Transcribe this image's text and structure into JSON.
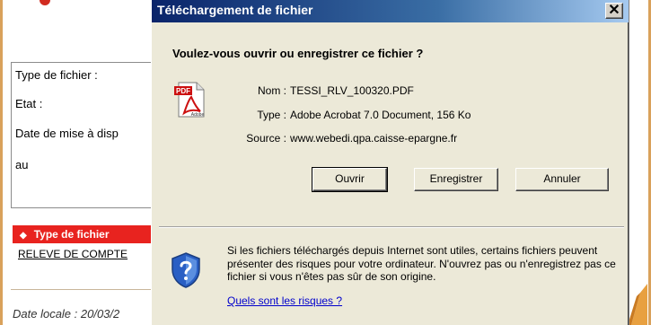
{
  "background": {
    "rows": [
      "Type de fichier :",
      "Etat :",
      "Date de mise à disp",
      "au"
    ],
    "tab_label": "Type de fichier",
    "link_text": "RELEVE DE COMPTE",
    "local_date": "Date locale : 20/03/2"
  },
  "dialog": {
    "title": "Téléchargement de fichier",
    "close_glyph": "✕",
    "question": "Voulez-vous ouvrir ou enregistrer ce fichier ?",
    "fields": {
      "name_label": "Nom :",
      "name_value": "TESSI_RLV_100320.PDF",
      "type_label": "Type :",
      "type_value": "Adobe Acrobat 7.0 Document, 156 Ko",
      "source_label": "Source :",
      "source_value": "www.webedi.qpa.caisse-epargne.fr"
    },
    "buttons": {
      "open": "Ouvrir",
      "save": "Enregistrer",
      "cancel": "Annuler"
    },
    "warning_text": "Si les fichiers téléchargés depuis Internet sont utiles, certains fichiers peuvent présenter des risques pour votre ordinateur. N'ouvrez pas ou n'enregistrez pas ce fichier si vous n'êtes pas sûr de son origine.",
    "risk_link": "Quels sont les risques ?",
    "icons": {
      "file": "pdf-file-icon",
      "security": "shield-question-icon"
    },
    "pdf_badge": "PDF",
    "adobe_badge": "Adobe"
  },
  "colors": {
    "titlebar_start": "#0a246a",
    "titlebar_end": "#a6caf0",
    "dialog_face": "#ece9d8",
    "tab_red": "#e8231f",
    "link_blue": "#0000cc"
  }
}
